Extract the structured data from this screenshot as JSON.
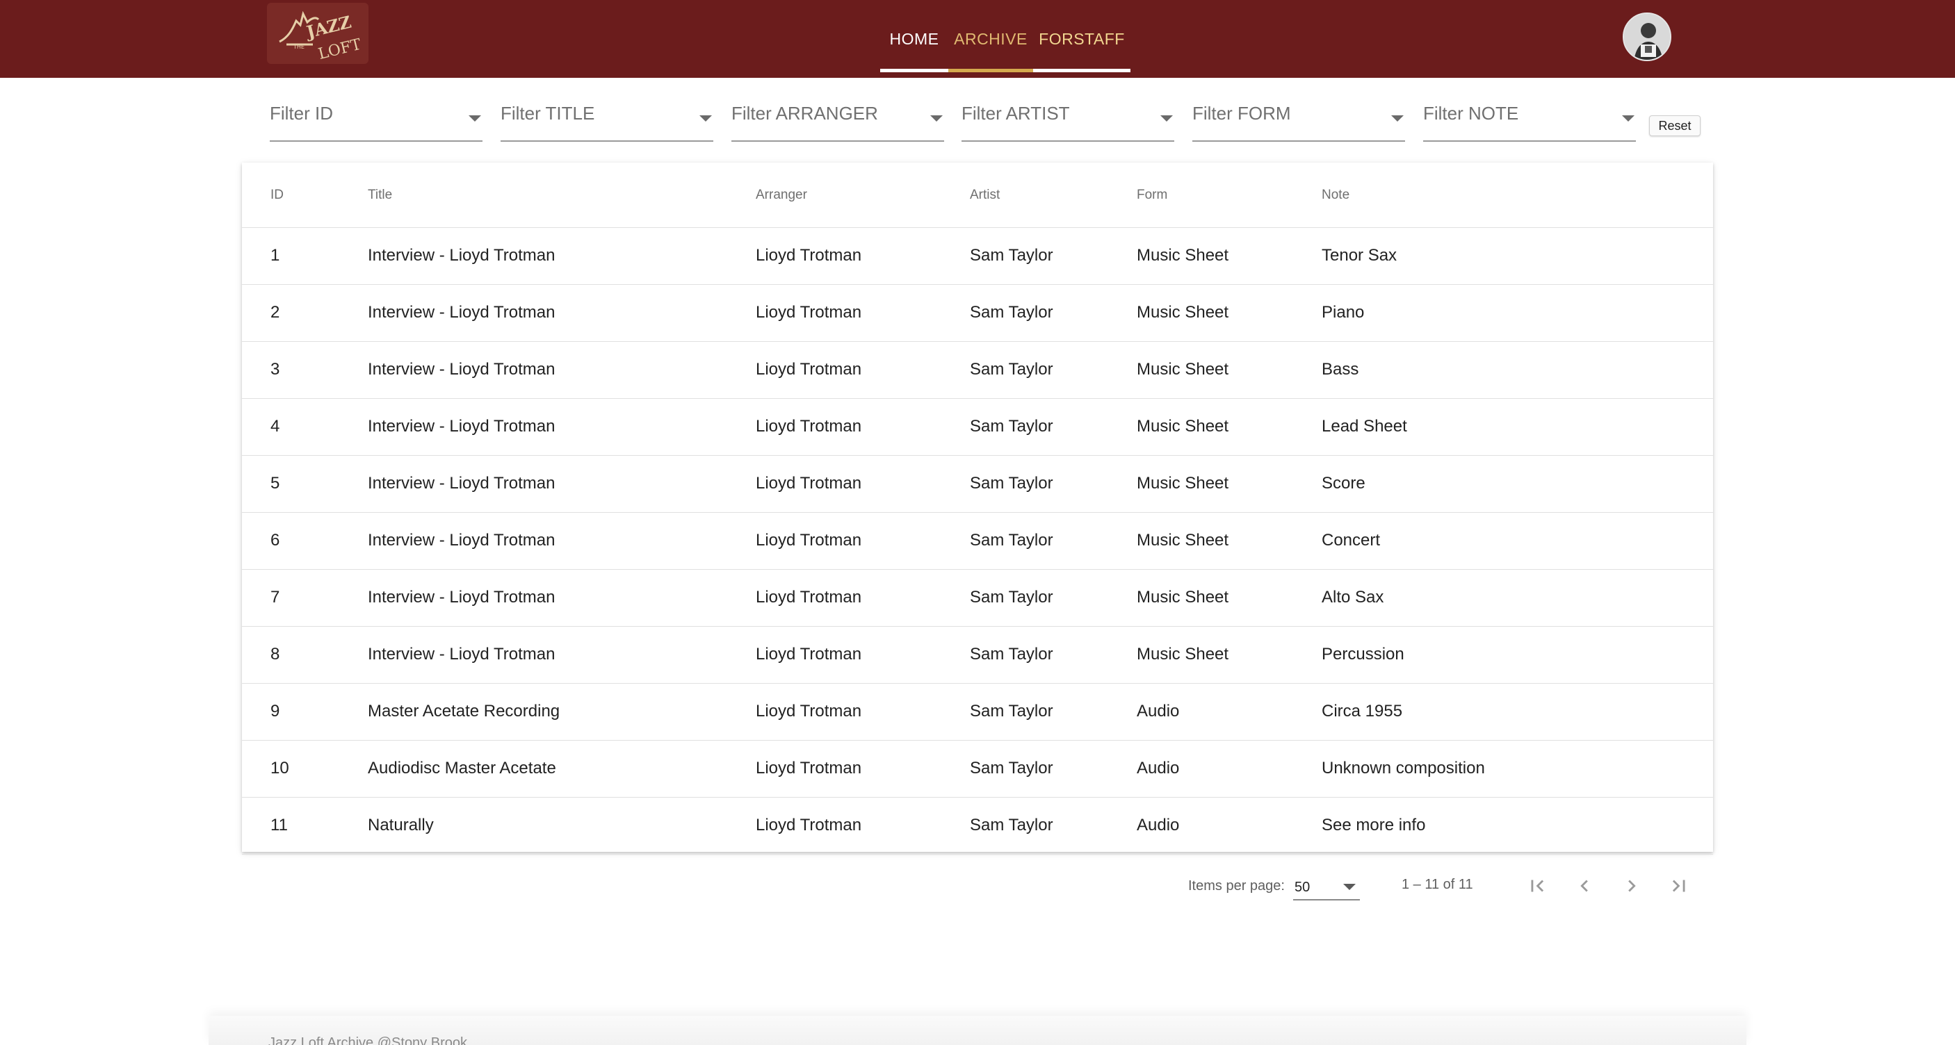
{
  "header": {
    "logo_text": "THE JAZZ LOFT",
    "nav": [
      {
        "label": "HOME"
      },
      {
        "label": "ARCHIVE"
      },
      {
        "label": "FORSTAFF"
      }
    ],
    "colors": {
      "bar": "#6b1c1c",
      "active_underline": "#d4a94e"
    }
  },
  "filters": [
    {
      "label": "Filter ID"
    },
    {
      "label": "Filter TITLE"
    },
    {
      "label": "Filter ARRANGER"
    },
    {
      "label": "Filter ARTIST"
    },
    {
      "label": "Filter FORM"
    },
    {
      "label": "Filter NOTE"
    }
  ],
  "reset_label": "Reset",
  "table": {
    "columns": [
      "ID",
      "Title",
      "Arranger",
      "Artist",
      "Form",
      "Note"
    ],
    "rows": [
      {
        "id": "1",
        "title": "Interview - Lioyd Trotman",
        "arranger": "Lioyd Trotman",
        "artist": "Sam Taylor",
        "form": "Music Sheet",
        "note": "Tenor Sax"
      },
      {
        "id": "2",
        "title": "Interview - Lioyd Trotman",
        "arranger": "Lioyd Trotman",
        "artist": "Sam Taylor",
        "form": "Music Sheet",
        "note": "Piano"
      },
      {
        "id": "3",
        "title": "Interview - Lioyd Trotman",
        "arranger": "Lioyd Trotman",
        "artist": "Sam Taylor",
        "form": "Music Sheet",
        "note": "Bass"
      },
      {
        "id": "4",
        "title": "Interview - Lioyd Trotman",
        "arranger": "Lioyd Trotman",
        "artist": "Sam Taylor",
        "form": "Music Sheet",
        "note": "Lead Sheet"
      },
      {
        "id": "5",
        "title": "Interview - Lioyd Trotman",
        "arranger": "Lioyd Trotman",
        "artist": "Sam Taylor",
        "form": "Music Sheet",
        "note": "Score"
      },
      {
        "id": "6",
        "title": "Interview - Lioyd Trotman",
        "arranger": "Lioyd Trotman",
        "artist": "Sam Taylor",
        "form": "Music Sheet",
        "note": "Concert"
      },
      {
        "id": "7",
        "title": "Interview - Lioyd Trotman",
        "arranger": "Lioyd Trotman",
        "artist": "Sam Taylor",
        "form": "Music Sheet",
        "note": "Alto Sax"
      },
      {
        "id": "8",
        "title": "Interview - Lioyd Trotman",
        "arranger": "Lioyd Trotman",
        "artist": "Sam Taylor",
        "form": "Music Sheet",
        "note": "Percussion"
      },
      {
        "id": "9",
        "title": "Master Acetate Recording",
        "arranger": "Lioyd Trotman",
        "artist": "Sam Taylor",
        "form": "Audio",
        "note": "Circa 1955"
      },
      {
        "id": "10",
        "title": "Audiodisc Master Acetate",
        "arranger": "Lioyd Trotman",
        "artist": "Sam Taylor",
        "form": "Audio",
        "note": "Unknown composition"
      },
      {
        "id": "11",
        "title": "Naturally",
        "arranger": "Lioyd Trotman",
        "artist": "Sam Taylor",
        "form": "Audio",
        "note": "See more info"
      }
    ]
  },
  "paginator": {
    "items_per_page_label": "Items per page:",
    "items_per_page_value": "50",
    "range_label": "1 – 11 of 11",
    "icons": [
      "first-page-icon",
      "previous-page-icon",
      "next-page-icon",
      "last-page-icon"
    ]
  },
  "footer": {
    "text": "Jazz Loft Archive @Stony Brook"
  }
}
